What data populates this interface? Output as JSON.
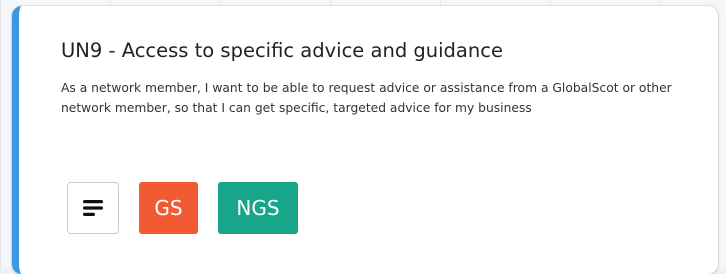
{
  "card": {
    "title": "UN9 - Access to specific advice and guidance",
    "description": "As a network member, I want to be able to request advice or assistance from a GlobalScot or other network member, so that I can get specific, targeted advice for my business",
    "accent_color": "#3b97e3"
  },
  "actions": {
    "menu_icon": "menu-lines-icon",
    "tags": [
      {
        "label": "GS",
        "color": "#f15a32"
      },
      {
        "label": "NGS",
        "color": "#17a689"
      }
    ]
  }
}
